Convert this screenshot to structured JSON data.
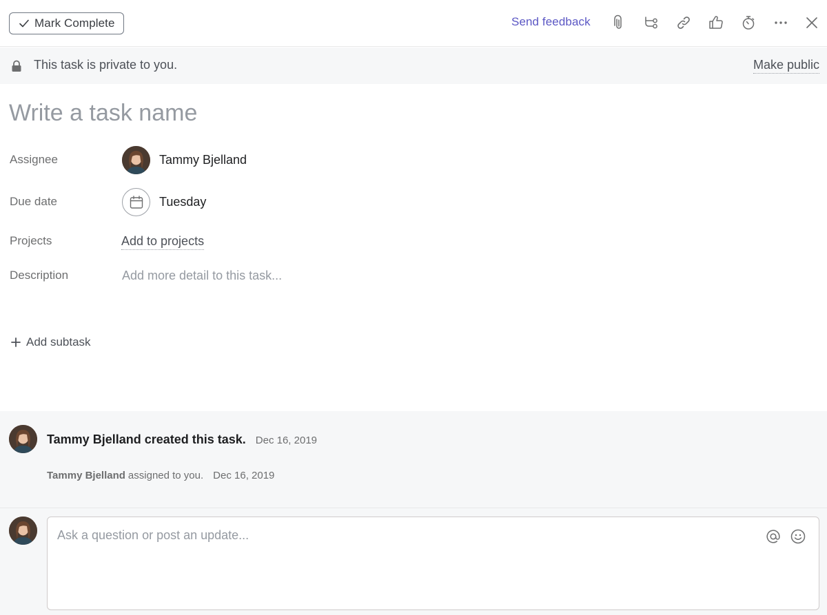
{
  "toolbar": {
    "mark_complete_label": "Mark Complete",
    "send_feedback_label": "Send feedback",
    "icons": [
      "paperclip-icon",
      "subtask-icon",
      "link-icon",
      "thumbs-up-icon",
      "stopwatch-icon",
      "more-icon",
      "close-icon"
    ]
  },
  "privacy": {
    "message": "This task is private to you.",
    "make_public_label": "Make public"
  },
  "task": {
    "name_placeholder": "Write a task name",
    "fields": {
      "assignee_label": "Assignee",
      "assignee_name": "Tammy Bjelland",
      "due_date_label": "Due date",
      "due_date_value": "Tuesday",
      "projects_label": "Projects",
      "projects_action": "Add to projects",
      "description_label": "Description",
      "description_placeholder": "Add more detail to this task..."
    },
    "add_subtask_label": "Add subtask"
  },
  "activity": {
    "created": {
      "text": "Tammy Bjelland created this task.",
      "date": "Dec 16, 2019"
    },
    "assigned": {
      "name": "Tammy Bjelland",
      "text": "assigned to you.",
      "date": "Dec 16, 2019"
    }
  },
  "comment": {
    "placeholder": "Ask a question or post an update..."
  },
  "colors": {
    "accent": "#5b57c4",
    "text_primary": "#1e1f21",
    "text_secondary": "#6d6e6f",
    "placeholder": "#959aa1",
    "panel_bg": "#f6f7f8"
  }
}
